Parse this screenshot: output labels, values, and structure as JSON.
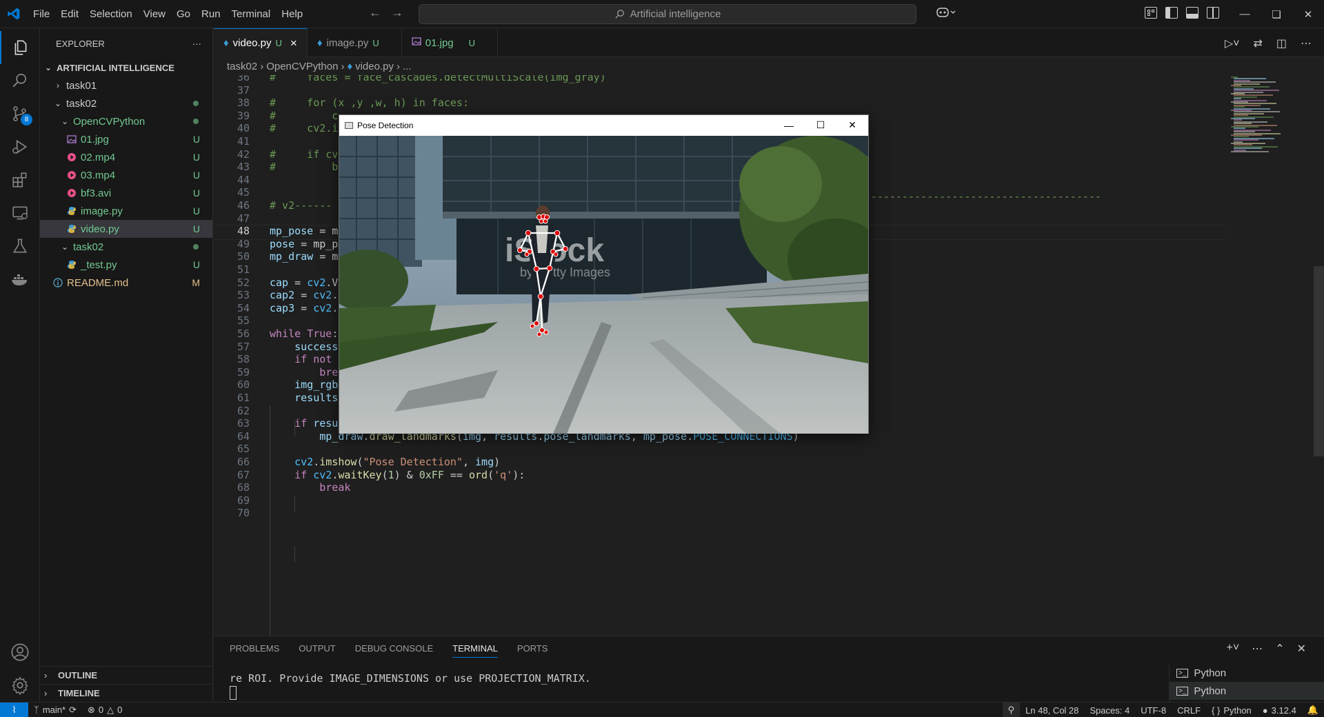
{
  "colors": {
    "accent": "#0078d4",
    "untracked": "#73c991",
    "modified": "#e2c08d",
    "landmark": "#e00000"
  },
  "menu": [
    "File",
    "Edit",
    "Selection",
    "View",
    "Go",
    "Run",
    "Terminal",
    "Help"
  ],
  "command_center": {
    "text": "Artificial intelligence"
  },
  "explorer": {
    "title": "EXPLORER",
    "more": "···",
    "root": "ARTIFICIAL INTELLIGENCE",
    "items": [
      {
        "label": "task01",
        "deco": ""
      },
      {
        "label": "task02",
        "deco": ""
      },
      {
        "label": "OpenCVPython",
        "deco": ""
      },
      {
        "label": "01.jpg",
        "deco": "U"
      },
      {
        "label": "02.mp4",
        "deco": "U"
      },
      {
        "label": "03.mp4",
        "deco": "U"
      },
      {
        "label": "bf3.avi",
        "deco": "U"
      },
      {
        "label": "image.py",
        "deco": "U"
      },
      {
        "label": "video.py",
        "deco": "U"
      },
      {
        "label": "task02",
        "deco": ""
      },
      {
        "label": "_test.py",
        "deco": "U"
      },
      {
        "label": "README.md",
        "deco": "M"
      }
    ],
    "outline": "OUTLINE",
    "timeline": "TIMELINE"
  },
  "activity": {
    "scm_badge": "8"
  },
  "tabs": [
    {
      "label": "video.py",
      "status": "U",
      "close": "×"
    },
    {
      "label": "image.py",
      "status": "U"
    },
    {
      "label": "01.jpg",
      "status": "U"
    }
  ],
  "breadcrumb": [
    "task02",
    "OpenCVPython",
    "video.py",
    "..."
  ],
  "code_lines": [
    {
      "n": "36",
      "t": "#     faces = face_cascades.detectMultiScale(img_gray)"
    },
    {
      "n": "37",
      "t": ""
    },
    {
      "n": "38",
      "t": "#     for (x ,y ,w, h) in faces:"
    },
    {
      "n": "39",
      "t": "#         c"
    },
    {
      "n": "40",
      "t": "#     cv2.i"
    },
    {
      "n": "41",
      "t": ""
    },
    {
      "n": "42",
      "t": "#     if cv"
    },
    {
      "n": "43",
      "t": "#         b"
    },
    {
      "n": "44",
      "t": ""
    },
    {
      "n": "45",
      "t": ""
    },
    {
      "n": "46",
      "t": "# v2------"
    },
    {
      "n": "47",
      "t": ""
    },
    {
      "n": "48",
      "t": "mp_pose = m"
    },
    {
      "n": "49",
      "t": "pose = mp_p"
    },
    {
      "n": "50",
      "t": "mp_draw = m"
    },
    {
      "n": "51",
      "t": ""
    },
    {
      "n": "52",
      "t": "cap = cv2.V"
    },
    {
      "n": "53",
      "t": "cap2 = cv2."
    },
    {
      "n": "54",
      "t": "cap3 = cv2."
    },
    {
      "n": "55",
      "t": ""
    },
    {
      "n": "56",
      "t": "while True:"
    },
    {
      "n": "57",
      "t": "    success"
    },
    {
      "n": "58",
      "t": "    if not "
    },
    {
      "n": "59",
      "t": "        break"
    },
    {
      "n": "60",
      "t": "    img_rgb = cv2.cvtColor(img, cv2.COLOR_BGR2RGB)"
    },
    {
      "n": "61",
      "t": "    results = pose.process(img_rgb)"
    },
    {
      "n": "62",
      "t": ""
    },
    {
      "n": "63",
      "t": "    if results.pose_landmarks:"
    },
    {
      "n": "64",
      "t": "        mp_draw.draw_landmarks(img, results.pose_landmarks, mp_pose.POSE_CONNECTIONS)"
    },
    {
      "n": "65",
      "t": ""
    },
    {
      "n": "66",
      "t": "    cv2.imshow(\"Pose Detection\", img)"
    },
    {
      "n": "67",
      "t": "    if cv2.waitKey(1) & 0xFF == ord('q'):"
    },
    {
      "n": "68",
      "t": "        break"
    },
    {
      "n": "69",
      "t": ""
    },
    {
      "n": "70",
      "t": ""
    }
  ],
  "pose_window": {
    "title": "Pose Detection",
    "watermark": "iStock",
    "watermark_sub": "by Getty Images"
  },
  "panel": {
    "tabs": [
      "PROBLEMS",
      "OUTPUT",
      "DEBUG CONSOLE",
      "TERMINAL",
      "PORTS"
    ],
    "active_tab": "TERMINAL",
    "terminal_text": "re ROI. Provide IMAGE_DIMENSIONS or use PROJECTION_MATRIX.",
    "terminals": [
      "Python",
      "Python"
    ]
  },
  "status": {
    "branch": "main*",
    "errors": "0",
    "warnings": "0",
    "cursor": "Ln 48, Col 28",
    "spaces": "Spaces: 4",
    "encoding": "UTF-8",
    "eol": "CRLF",
    "language": "Python",
    "python_version": "3.12.4"
  }
}
